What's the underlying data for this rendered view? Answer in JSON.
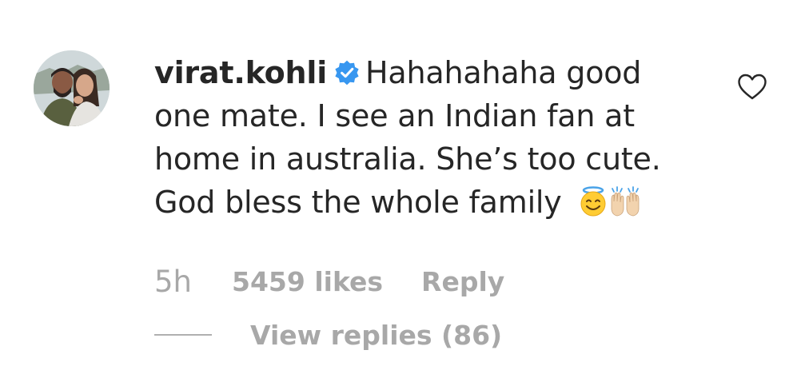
{
  "comment": {
    "username": "virat.kohli",
    "verified": true,
    "icons": {
      "avatar": "avatar-photo",
      "verified": "verified-badge-icon",
      "like": "heart-outline-icon",
      "emoji_1": "smiling-face-with-halo",
      "emoji_2": "raising-hands"
    },
    "lines": [
      "Hahahahaha good",
      "one mate. I see an Indian fan at",
      "home in australia. She’s too cute.",
      "God bless the whole family"
    ],
    "timestamp": "5h",
    "likes": "5459 likes",
    "reply_label": "Reply",
    "view_replies": "View replies (86)"
  },
  "colors": {
    "text": "#262626",
    "secondary": "#a8a8a8",
    "verified": "#3897f0",
    "background": "#ffffff"
  }
}
